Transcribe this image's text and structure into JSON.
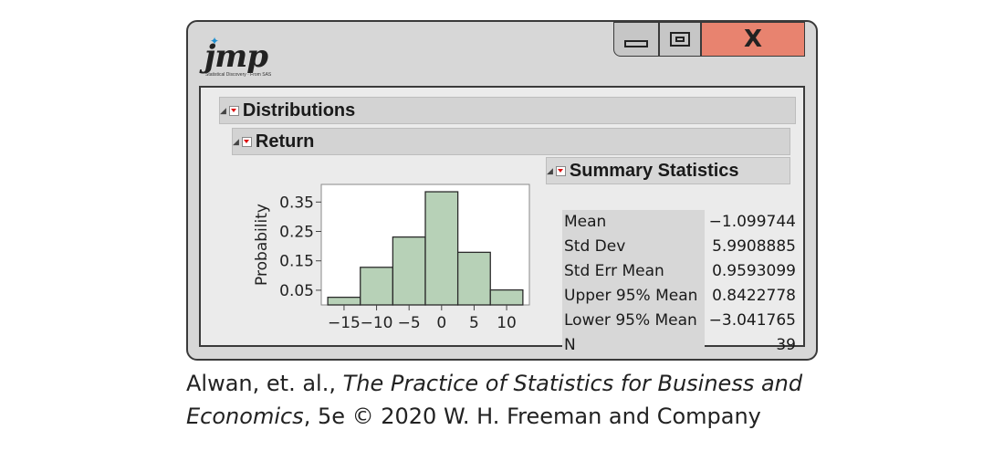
{
  "window": {
    "logo_text": "jmp",
    "logo_tagline": "Statistical Discovery · From SAS",
    "buttons": {
      "minimize": "minimize",
      "maximize": "maximize",
      "close": "X"
    }
  },
  "outline": {
    "distributions_title": "Distributions",
    "return_title": "Return",
    "summary_title": "Summary Statistics"
  },
  "summary_stats": [
    {
      "label": "Mean",
      "value": "−1.099744"
    },
    {
      "label": "Std Dev",
      "value": "5.9908885"
    },
    {
      "label": "Std Err Mean",
      "value": "0.9593099"
    },
    {
      "label": "Upper 95% Mean",
      "value": "0.8422778"
    },
    {
      "label": "Lower 95% Mean",
      "value": "−3.041765"
    },
    {
      "label": "N",
      "value": "39"
    }
  ],
  "chart_data": {
    "type": "bar",
    "title": "",
    "xlabel": "",
    "ylabel": "Probability",
    "bins": [
      {
        "from": -17.5,
        "to": -12.5,
        "value": 0.026
      },
      {
        "from": -12.5,
        "to": -7.5,
        "value": 0.128
      },
      {
        "from": -7.5,
        "to": -2.5,
        "value": 0.231
      },
      {
        "from": -2.5,
        "to": 2.5,
        "value": 0.385
      },
      {
        "from": 2.5,
        "to": 7.5,
        "value": 0.179
      },
      {
        "from": 7.5,
        "to": 12.5,
        "value": 0.051
      }
    ],
    "xlim": [
      -18.5,
      13.5
    ],
    "ylim": [
      0,
      0.41
    ],
    "xticks": [
      -15,
      -10,
      -5,
      0,
      5,
      10
    ],
    "xtick_labels": [
      "−15",
      "−10",
      "−5",
      "0",
      "5",
      "10"
    ],
    "yticks": [
      0.05,
      0.15,
      0.25,
      0.35
    ],
    "ytick_labels": [
      "0.05",
      "0.15",
      "0.25",
      "0.35"
    ],
    "bar_color": "#b7d1b7",
    "grid": false
  },
  "caption": {
    "line1_author": "Alwan, et. al., ",
    "line1_title": "The Practice of Statistics for Business and",
    "line2_title": "Economics",
    "line2_rest": ", 5e © 2020 W. H. Freeman and Company"
  }
}
